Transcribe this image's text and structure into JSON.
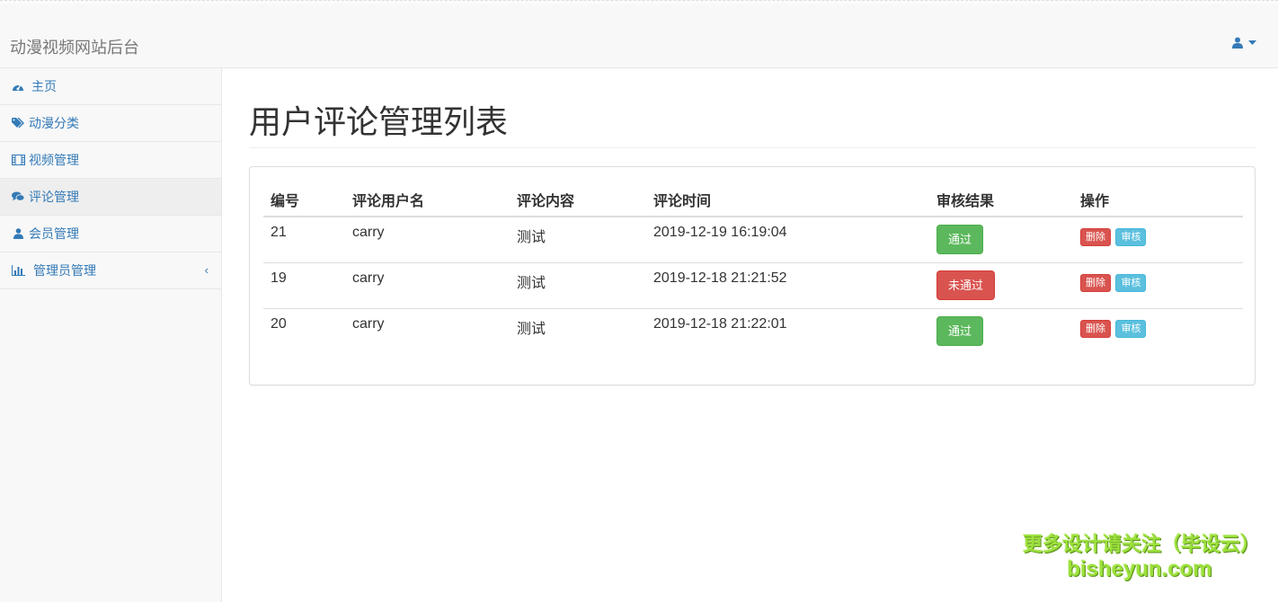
{
  "navbar": {
    "brand": "动漫视频网站后台",
    "user_icon": "user-icon"
  },
  "sidebar": {
    "items": [
      {
        "label": "主页",
        "icon": "dashboard-icon"
      },
      {
        "label": "动漫分类",
        "icon": "tags-icon"
      },
      {
        "label": "视频管理",
        "icon": "film-icon"
      },
      {
        "label": "评论管理",
        "icon": "comments-icon",
        "active": true
      },
      {
        "label": "会员管理",
        "icon": "user-icon"
      },
      {
        "label": "管理员管理",
        "icon": "bar-chart-icon",
        "arrow": "‹"
      }
    ]
  },
  "main": {
    "title": "用户评论管理列表",
    "table": {
      "headers": [
        "编号",
        "评论用户名",
        "评论内容",
        "评论时间",
        "审核结果",
        "操作"
      ],
      "rows": [
        {
          "id": "21",
          "user": "carry",
          "content": "测试",
          "time": "2019-12-19 16:19:04",
          "status": "通过",
          "status_type": "pass"
        },
        {
          "id": "19",
          "user": "carry",
          "content": "测试",
          "time": "2019-12-18 21:21:52",
          "status": "未通过",
          "status_type": "fail"
        },
        {
          "id": "20",
          "user": "carry",
          "content": "测试",
          "time": "2019-12-18 21:22:01",
          "status": "通过",
          "status_type": "pass"
        }
      ],
      "actions": {
        "delete_label": "删除",
        "review_label": "审核"
      }
    }
  },
  "colors": {
    "link": "#337ab7",
    "success": "#5cb85c",
    "danger": "#d9534f",
    "info": "#5bc0de"
  },
  "watermark": {
    "line1": "更多设计请关注（毕设云）",
    "line2": "bisheyun.com"
  }
}
